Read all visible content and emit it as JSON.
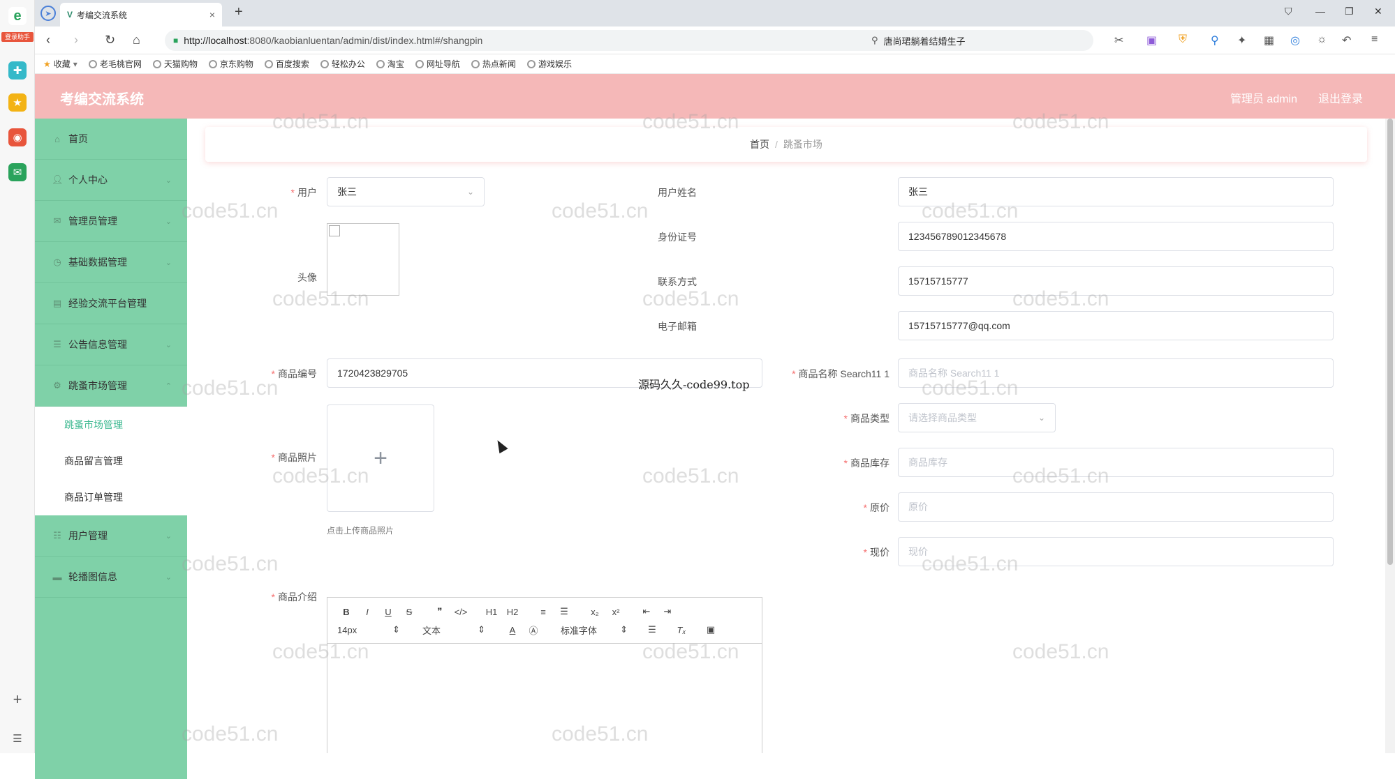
{
  "dock": {
    "badge": "登录助手"
  },
  "browser": {
    "tab_title": "考编交流系统",
    "tab_favicon": "V",
    "url_host": "http://localhost",
    "url_rest": ":8080/kaobianluentan/admin/dist/index.html#/shangpin",
    "search_text": "唐尚珺躺着结婚生子"
  },
  "bookmarks": [
    "收藏",
    "老毛桃官网",
    "天猫购物",
    "京东购物",
    "百度搜索",
    "轻松办公",
    "淘宝",
    "网址导航",
    "热点新闻",
    "游戏娱乐"
  ],
  "header": {
    "title": "考编交流系统",
    "admin": "管理员 admin",
    "logout": "退出登录"
  },
  "sidebar": {
    "items_top": [
      {
        "label": "首页",
        "icon": "home-icon"
      },
      {
        "label": "个人中心",
        "icon": "user-icon"
      },
      {
        "label": "管理员管理",
        "icon": "mail-icon"
      },
      {
        "label": "基础数据管理",
        "icon": "clock-icon"
      },
      {
        "label": "经验交流平台管理",
        "icon": "clipboard-icon"
      },
      {
        "label": "公告信息管理",
        "icon": "list-icon"
      },
      {
        "label": "跳蚤市场管理",
        "icon": "gear-icon"
      }
    ],
    "submenu": [
      "跳蚤市场管理",
      "商品留言管理",
      "商品订单管理"
    ],
    "items_bottom": [
      {
        "label": "用户管理",
        "icon": "sliders-icon"
      },
      {
        "label": "轮播图信息",
        "icon": "image-icon"
      }
    ]
  },
  "breadcrumb": {
    "home": "首页",
    "separator": "/",
    "current": "跳蚤市场"
  },
  "form": {
    "user_label": "用户",
    "user_value": "张三",
    "avatar_label": "头像",
    "username_label": "用户姓名",
    "username_value": "张三",
    "idcard_label": "身份证号",
    "idcard_value": "123456789012345678",
    "phone_label": "联系方式",
    "phone_value": "15715715777",
    "email_label": "电子邮箱",
    "email_value": "15715715777@qq.com",
    "code_label": "商品编号",
    "code_value": "1720423829705",
    "name_label": "商品名称 Search11 1",
    "name_placeholder": "商品名称  Search11 1",
    "photo_label": "商品照片",
    "photo_tip": "点击上传商品照片",
    "upload_plus": "+",
    "type_label": "商品类型",
    "type_placeholder": "请选择商品类型",
    "stock_label": "商品库存",
    "stock_placeholder": "商品库存",
    "orig_price_label": "原价",
    "orig_price_placeholder": "原价",
    "price_label": "现价",
    "price_placeholder": "现价",
    "intro_label": "商品介绍"
  },
  "editor": {
    "row1": [
      "B",
      "I",
      "U",
      "S",
      "❞",
      "</>",
      "H1",
      "H2",
      "≡",
      "☰",
      "x₂",
      "x²",
      "⇤",
      "⇥"
    ],
    "font_size": "14px",
    "block": "文本",
    "font_family": "标准字体"
  },
  "overlay_text": "源码久久-code99.top",
  "watermark": "code51.cn",
  "colors": {
    "header": "#f5b8b8",
    "sidebar": "#7fd1a8",
    "active": "#3cb890",
    "required": "#f56c6c"
  }
}
